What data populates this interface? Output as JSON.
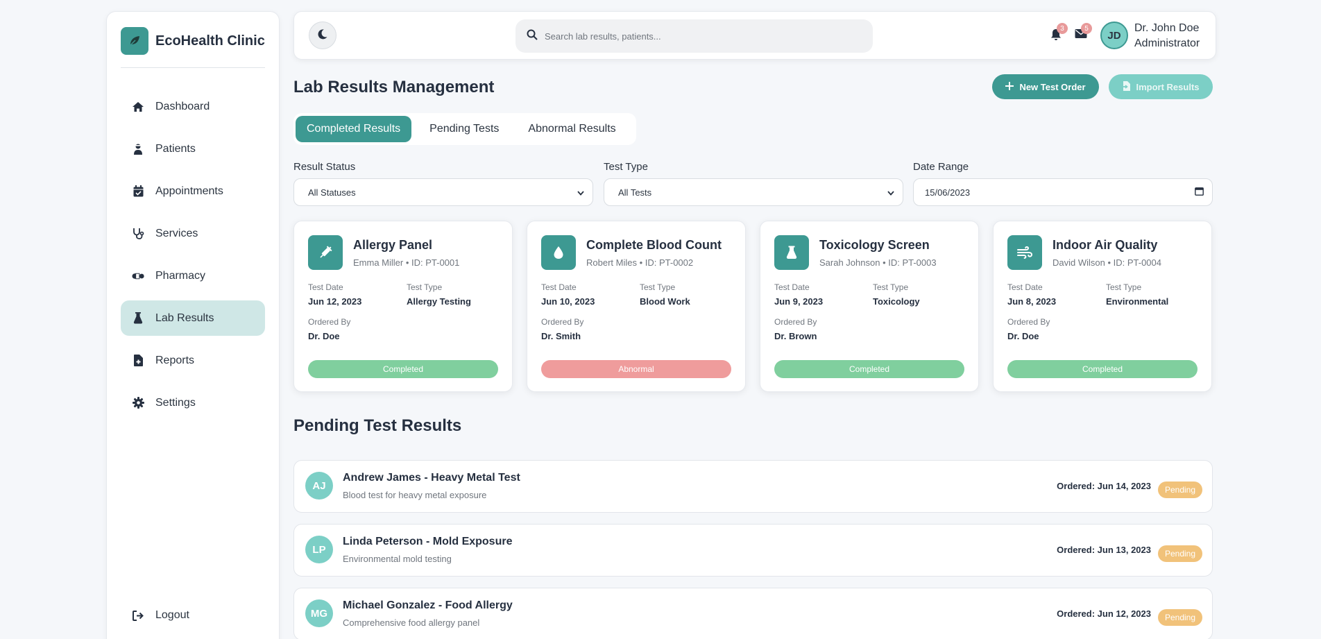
{
  "brand": {
    "name": "EcoHealth Clinic",
    "icon": "leaf-icon"
  },
  "sidebar": {
    "items": [
      {
        "label": "Dashboard",
        "icon": "home-icon"
      },
      {
        "label": "Patients",
        "icon": "user-injured-icon"
      },
      {
        "label": "Appointments",
        "icon": "calendar-check-icon"
      },
      {
        "label": "Services",
        "icon": "stethoscope-icon"
      },
      {
        "label": "Pharmacy",
        "icon": "pills-icon"
      },
      {
        "label": "Lab Results",
        "icon": "flask-icon",
        "active": true
      },
      {
        "label": "Reports",
        "icon": "file-medical-icon"
      },
      {
        "label": "Settings",
        "icon": "gear-icon"
      }
    ],
    "logout": "Logout"
  },
  "topbar": {
    "search_placeholder": "Search lab results, patients...",
    "notifications_count": "3",
    "messages_count": "5",
    "user_initials": "JD",
    "user_name": "Dr. John Doe",
    "user_role": "Administrator"
  },
  "page": {
    "title": "Lab Results Management",
    "new_test_label": "New Test Order",
    "import_label": "Import Results"
  },
  "tabs": [
    "Completed Results",
    "Pending Tests",
    "Abnormal Results"
  ],
  "filters": {
    "status_label": "Result Status",
    "status_value": "All Statuses",
    "type_label": "Test Type",
    "type_value": "All Tests",
    "date_label": "Date Range",
    "date_value": "15/06/2023"
  },
  "labels": {
    "test_date": "Test Date",
    "test_type": "Test Type",
    "ordered_by": "Ordered By"
  },
  "cards": [
    {
      "title": "Allergy Panel",
      "sub": "Emma Miller • ID: PT-0001",
      "test_date": "Jun 12, 2023",
      "test_type": "Allergy Testing",
      "ordered_by": "Dr. Doe",
      "status": "Completed",
      "icon": "syringe-icon"
    },
    {
      "title": "Complete Blood Count",
      "sub": "Robert Miles • ID: PT-0002",
      "test_date": "Jun 10, 2023",
      "test_type": "Blood Work",
      "ordered_by": "Dr. Smith",
      "status": "Abnormal",
      "icon": "droplet-icon"
    },
    {
      "title": "Toxicology Screen",
      "sub": "Sarah Johnson • ID: PT-0003",
      "test_date": "Jun 9, 2023",
      "test_type": "Toxicology",
      "ordered_by": "Dr. Brown",
      "status": "Completed",
      "icon": "flask-icon"
    },
    {
      "title": "Indoor Air Quality",
      "sub": "David Wilson • ID: PT-0004",
      "test_date": "Jun 8, 2023",
      "test_type": "Environmental",
      "ordered_by": "Dr. Doe",
      "status": "Completed",
      "icon": "wind-icon"
    }
  ],
  "pending": {
    "title": "Pending Test Results",
    "items": [
      {
        "initials": "AJ",
        "title": "Andrew James - Heavy Metal Test",
        "desc": "Blood test for heavy metal exposure",
        "date": "Ordered: Jun 14, 2023",
        "status": "Pending"
      },
      {
        "initials": "LP",
        "title": "Linda Peterson - Mold Exposure",
        "desc": "Environmental mold testing",
        "date": "Ordered: Jun 13, 2023",
        "status": "Pending"
      },
      {
        "initials": "MG",
        "title": "Michael Gonzalez - Food Allergy",
        "desc": "Comprehensive food allergy panel",
        "date": "Ordered: Jun 12, 2023",
        "status": "Pending"
      }
    ]
  },
  "colors": {
    "accent": "#3d9992",
    "accent_light": "#7ccfc6",
    "completed": "#80cf9e",
    "abnormal": "#ef9c9c",
    "pending": "#f1c27a"
  }
}
